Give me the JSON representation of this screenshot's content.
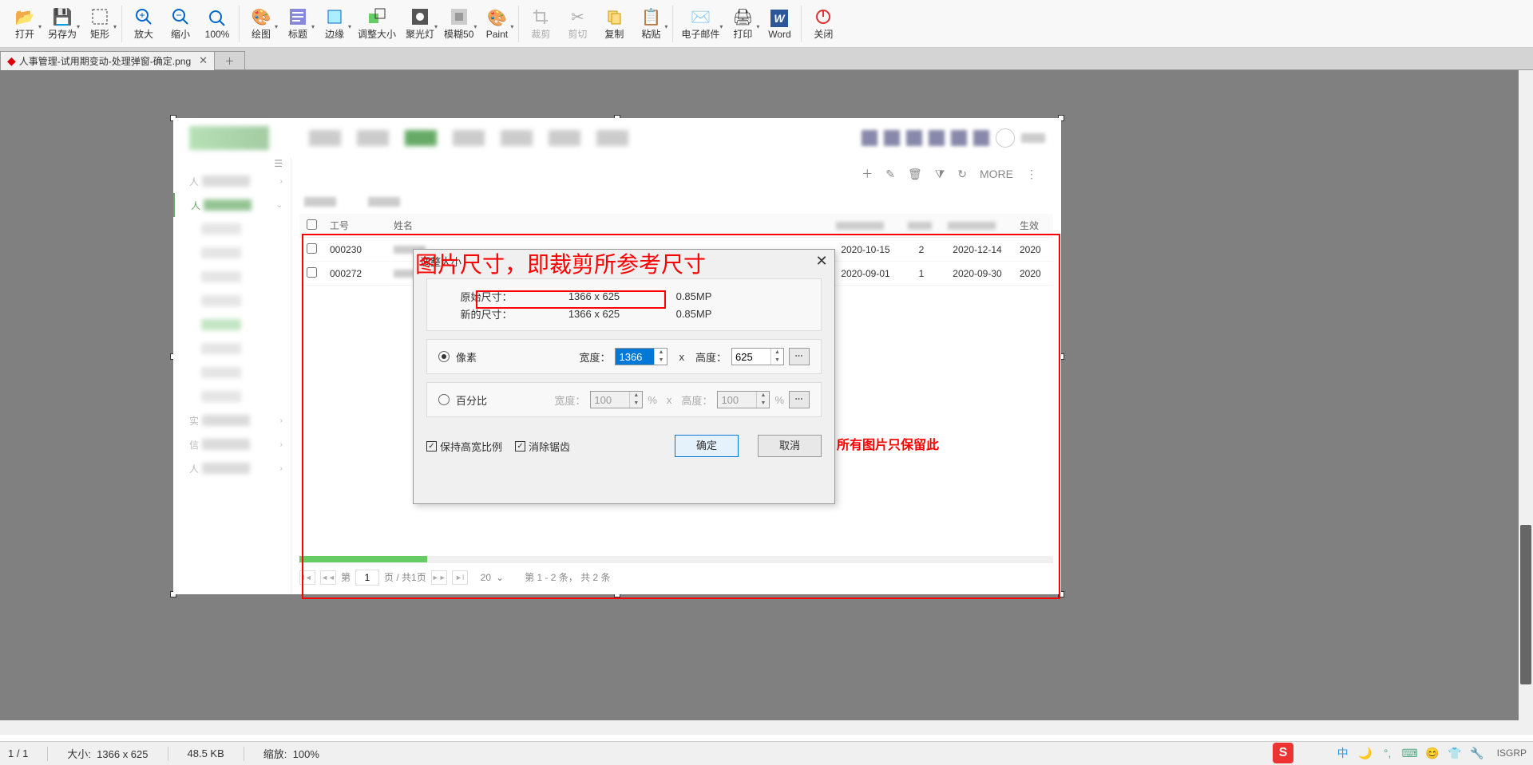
{
  "toolbar": {
    "open": "打开",
    "saveAs": "另存为",
    "rect": "矩形",
    "zoomIn": "放大",
    "zoomOut": "缩小",
    "zoom100": "100%",
    "draw": "绘图",
    "title": "标题",
    "edge": "边缘",
    "resize": "调整大小",
    "spotlight": "聚光灯",
    "blur50": "模糊50",
    "paint": "Paint",
    "crop": "裁剪",
    "cut": "剪切",
    "copy": "复制",
    "paste": "粘贴",
    "email": "电子邮件",
    "print": "打印",
    "word": "Word",
    "close": "关闭"
  },
  "tab": {
    "name": "人事管理-试用期变动-处理弹窗-确定.png"
  },
  "annotation1": "图片尺寸，即裁剪所参考尺寸",
  "annotation2": "所有图片只保留此",
  "dialog": {
    "title": "调整大小",
    "origLabel": "原始尺寸：",
    "origVal": "1366 x 625",
    "origMP": "0.85MP",
    "newLabel": "新的尺寸：",
    "newVal": "1366 x 625",
    "newMP": "0.85MP",
    "pixel": "像素",
    "percent": "百分比",
    "widthLabel": "宽度：",
    "heightLabel": "高度：",
    "widthPx": "1366",
    "heightPx": "625",
    "widthPct": "100",
    "heightPct": "100",
    "keepRatio": "保持高宽比例",
    "antialias": "消除锯齿",
    "ok": "确定",
    "cancel": "取消",
    "x": "x",
    "pct": "%"
  },
  "webpage": {
    "side": {
      "p1": "人",
      "p2": "人",
      "exp": "实",
      "info": "信",
      "hr": "人"
    },
    "tableHeader": {
      "id": "工号",
      "name": "姓名",
      "eff": "生效"
    },
    "rows": [
      {
        "id": "000230",
        "d1": "2020-10-15",
        "n": "2",
        "d2": "2020-12-14",
        "d3": "2020"
      },
      {
        "id": "000272",
        "d1": "2020-09-01",
        "n": "1",
        "d2": "2020-09-30",
        "d3": "2020"
      }
    ],
    "toolbarMore": "MORE",
    "pager": {
      "pageLabel": "第",
      "pageOf": "页 / 共1页",
      "size": "20",
      "info": "第 1 - 2 条， 共 2 条",
      "page": "1"
    }
  },
  "status": {
    "page": "1 / 1",
    "sizeLabel": "大小:",
    "size": "1366 x 625",
    "fileSize": "48.5 KB",
    "zoomLabel": "缩放:",
    "zoom": "100%",
    "isgrp": "ISGRP"
  }
}
